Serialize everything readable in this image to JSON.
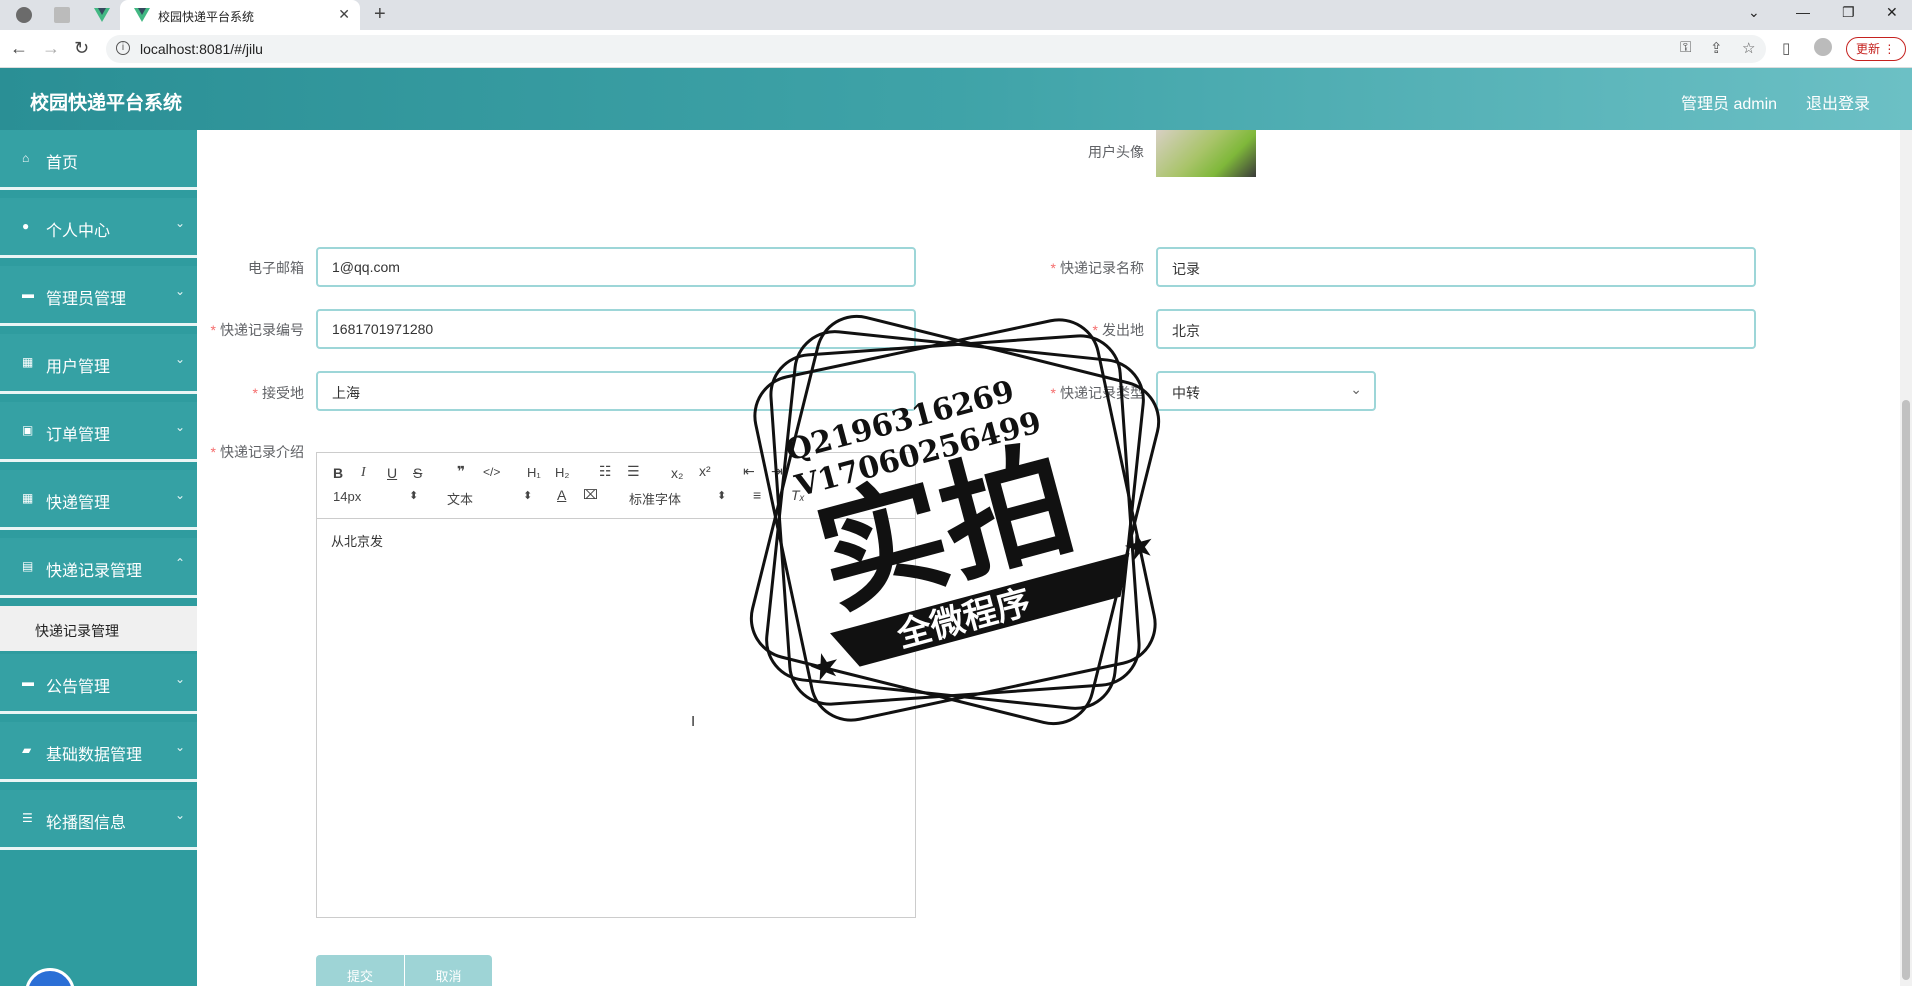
{
  "browser": {
    "tab_title": "校园快递平台系统",
    "url": "localhost:8081/#/jilu",
    "update_label": "更新"
  },
  "header": {
    "title": "校园快递平台系统",
    "admin_label": "管理员 admin",
    "logout_label": "退出登录"
  },
  "sidebar": {
    "items": [
      {
        "label": "首页",
        "icon": "home-icon"
      },
      {
        "label": "个人中心",
        "icon": "user-icon"
      },
      {
        "label": "管理员管理",
        "icon": "chat-icon"
      },
      {
        "label": "用户管理",
        "icon": "grid-icon"
      },
      {
        "label": "订单管理",
        "icon": "briefcase-icon"
      },
      {
        "label": "快递管理",
        "icon": "grid-icon"
      },
      {
        "label": "快递记录管理",
        "icon": "document-icon"
      },
      {
        "label": "公告管理",
        "icon": "printer-icon"
      },
      {
        "label": "基础数据管理",
        "icon": "ticket-icon"
      },
      {
        "label": "轮播图信息",
        "icon": "sliders-icon"
      }
    ],
    "active_sub": "快递记录管理"
  },
  "form": {
    "avatar_label": "用户头像",
    "email_label": "电子邮箱",
    "email_value": "1@qq.com",
    "record_name_label": "快递记录名称",
    "record_name_value": "记录",
    "record_no_label": "快递记录编号",
    "record_no_value": "1681701971280",
    "origin_label": "发出地",
    "origin_value": "北京",
    "dest_label": "接受地",
    "dest_value": "上海",
    "type_label": "快递记录类型",
    "type_value": "中转",
    "intro_label": "快递记录介绍",
    "intro_value": "从北京发",
    "submit_label": "提交",
    "cancel_label": "取消"
  },
  "editor": {
    "font_size": "14px",
    "block_format": "文本",
    "font_family": "标准字体",
    "sub_label": "x₂",
    "sup_label": "x²"
  },
  "stamp": {
    "line1": "Q2196316269",
    "line2": "V17060256499",
    "big_text": "实拍",
    "banner_text": "全微程序"
  }
}
